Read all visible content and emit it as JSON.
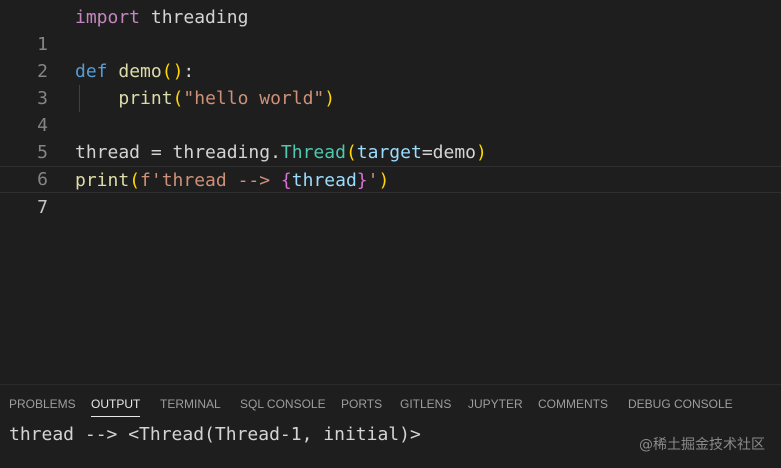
{
  "editor": {
    "lines": [
      {
        "number": "1",
        "tokens": [
          "import",
          " threading"
        ]
      },
      {
        "number": "2",
        "tokens": []
      },
      {
        "number": "3",
        "tokens": [
          "def",
          " ",
          "demo",
          "(",
          ")",
          ":"
        ]
      },
      {
        "number": "4",
        "tokens": [
          "    ",
          "print",
          "(",
          "\"hello world\"",
          ")"
        ]
      },
      {
        "number": "5",
        "tokens": []
      },
      {
        "number": "6",
        "tokens": [
          "thread = threading.",
          "Thread",
          "(",
          "target",
          "=demo",
          ")"
        ]
      },
      {
        "number": "7",
        "tokens": [
          "print",
          "(",
          "f'thread --> ",
          "{",
          "thread",
          "}",
          "'",
          ")"
        ]
      }
    ]
  },
  "panel": {
    "tabs": [
      {
        "label": "PROBLEMS",
        "active": false
      },
      {
        "label": "OUTPUT",
        "active": true
      },
      {
        "label": "TERMINAL",
        "active": false
      },
      {
        "label": "SQL CONSOLE",
        "active": false
      },
      {
        "label": "PORTS",
        "active": false
      },
      {
        "label": "GITLENS",
        "active": false
      },
      {
        "label": "JUPYTER",
        "active": false
      },
      {
        "label": "COMMENTS",
        "active": false
      },
      {
        "label": "DEBUG CONSOLE",
        "active": false
      }
    ],
    "output": "thread --> <Thread(Thread-1, initial)>"
  },
  "watermark": "@稀土掘金技术社区",
  "colors": {
    "background": "#1e1e1e",
    "keyword_control": "#c586c0",
    "keyword": "#569cd6",
    "function": "#dcdcaa",
    "class": "#4ec9b0",
    "string": "#ce9178",
    "parameter": "#9cdcfe",
    "bracket_level1": "#ffd700",
    "bracket_level2": "#da70d6"
  }
}
